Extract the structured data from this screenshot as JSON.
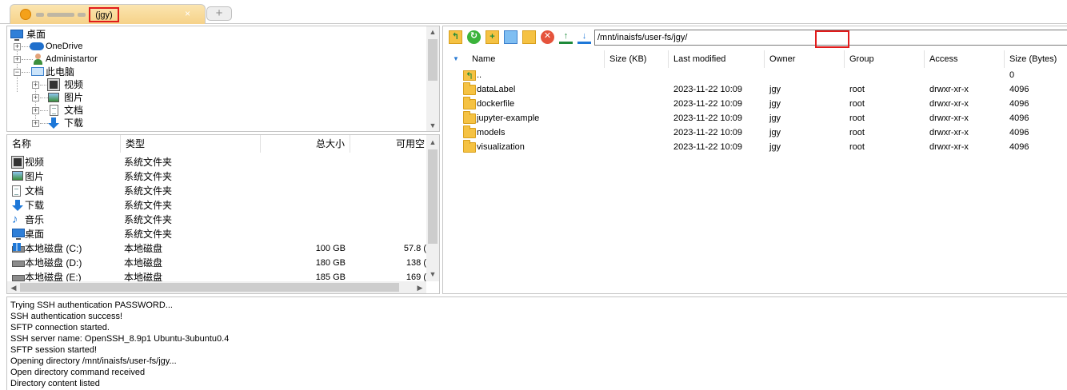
{
  "tab": {
    "label": "(jgy)",
    "new_tab_symbol": "+",
    "close_symbol": "×"
  },
  "tree": {
    "items": [
      {
        "label": "桌面",
        "icon": "desktop-icon"
      },
      {
        "label": "OneDrive",
        "icon": "onedrive-cloud-icon"
      },
      {
        "label": "Administartor",
        "icon": "user-icon"
      },
      {
        "label": "此电脑",
        "icon": "computer-icon"
      },
      {
        "label": "视频",
        "icon": "video-folder-icon"
      },
      {
        "label": "图片",
        "icon": "pictures-folder-icon"
      },
      {
        "label": "文档",
        "icon": "documents-folder-icon"
      },
      {
        "label": "下载",
        "icon": "download-folder-icon"
      }
    ]
  },
  "local_list": {
    "headers": [
      "名称",
      "类型",
      "总大小",
      "可用空"
    ],
    "rows": [
      {
        "name": "视频",
        "type": "系统文件夹",
        "total": "",
        "free": "",
        "icon": "video-folder-icon"
      },
      {
        "name": "图片",
        "type": "系统文件夹",
        "total": "",
        "free": "",
        "icon": "pictures-folder-icon"
      },
      {
        "name": "文档",
        "type": "系统文件夹",
        "total": "",
        "free": "",
        "icon": "documents-folder-icon"
      },
      {
        "name": "下载",
        "type": "系统文件夹",
        "total": "",
        "free": "",
        "icon": "download-folder-icon"
      },
      {
        "name": "音乐",
        "type": "系统文件夹",
        "total": "",
        "free": "",
        "icon": "music-folder-icon"
      },
      {
        "name": "桌面",
        "type": "系统文件夹",
        "total": "",
        "free": "",
        "icon": "desktop-icon"
      },
      {
        "name": "本地磁盘 (C:)",
        "type": "本地磁盘",
        "total": "100 GB",
        "free": "57.8 (",
        "icon": "windows-drive-icon"
      },
      {
        "name": "本地磁盘 (D:)",
        "type": "本地磁盘",
        "total": "180 GB",
        "free": "138 (",
        "icon": "drive-icon"
      },
      {
        "name": "本地磁盘 (E:)",
        "type": "本地磁盘",
        "total": "185 GB",
        "free": "169 (",
        "icon": "drive-icon"
      }
    ]
  },
  "remote": {
    "path": "/mnt/inaisfs/user-fs/jgy/",
    "toolbar": [
      "parent-folder-icon",
      "refresh-icon",
      "new-folder-icon",
      "new-file-icon",
      "folder-icon",
      "delete-icon",
      "upload-icon",
      "download-icon"
    ],
    "headers": [
      "Name",
      "Size (KB)",
      "Last modified",
      "Owner",
      "Group",
      "Access",
      "Size (Bytes)"
    ],
    "rows": [
      {
        "name": "..",
        "size_kb": "",
        "modified": "",
        "owner": "",
        "group": "",
        "access": "",
        "size_bytes": "0",
        "icon": "parent-folder-icon"
      },
      {
        "name": "dataLabel",
        "size_kb": "",
        "modified": "2023-11-22 10:09",
        "owner": "jgy",
        "group": "root",
        "access": "drwxr-xr-x",
        "size_bytes": "4096",
        "icon": "folder-icon"
      },
      {
        "name": "dockerfile",
        "size_kb": "",
        "modified": "2023-11-22 10:09",
        "owner": "jgy",
        "group": "root",
        "access": "drwxr-xr-x",
        "size_bytes": "4096",
        "icon": "folder-icon"
      },
      {
        "name": "jupyter-example",
        "size_kb": "",
        "modified": "2023-11-22 10:09",
        "owner": "jgy",
        "group": "root",
        "access": "drwxr-xr-x",
        "size_bytes": "4096",
        "icon": "folder-icon"
      },
      {
        "name": "models",
        "size_kb": "",
        "modified": "2023-11-22 10:09",
        "owner": "jgy",
        "group": "root",
        "access": "drwxr-xr-x",
        "size_bytes": "4096",
        "icon": "folder-icon"
      },
      {
        "name": "visualization",
        "size_kb": "",
        "modified": "2023-11-22 10:09",
        "owner": "jgy",
        "group": "root",
        "access": "drwxr-xr-x",
        "size_bytes": "4096",
        "icon": "folder-icon"
      }
    ]
  },
  "log": {
    "lines": [
      "Trying SSH authentication PASSWORD...",
      "SSH authentication success!",
      "SFTP connection started.",
      "SSH server name: OpenSSH_8.9p1 Ubuntu-3ubuntu0.4",
      "SFTP session started!",
      "Opening directory /mnt/inaisfs/user-fs/jgy...",
      "Open directory command received",
      "Directory content listed"
    ]
  },
  "colors": {
    "highlight": "#e11b1b",
    "tab_active": "#f6d289",
    "folder": "#f5c243"
  }
}
